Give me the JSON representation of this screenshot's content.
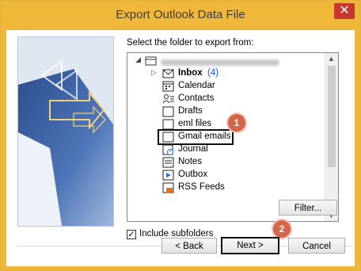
{
  "window": {
    "title": "Export Outlook Data File",
    "close_glyph": "✕"
  },
  "prompt": "Select the folder to export from:",
  "tree": {
    "items": [
      {
        "label": "Inbox",
        "count": "(4)",
        "icon": "inbox-icon"
      },
      {
        "label": "Calendar",
        "icon": "calendar-icon"
      },
      {
        "label": "Contacts",
        "icon": "contacts-icon"
      },
      {
        "label": "Drafts",
        "icon": "folder-icon"
      },
      {
        "label": "eml files",
        "icon": "folder-icon"
      },
      {
        "label": "Gmail emails",
        "icon": "folder-icon"
      },
      {
        "label": "Journal",
        "icon": "journal-icon"
      },
      {
        "label": "Notes",
        "icon": "notes-icon"
      },
      {
        "label": "Outbox",
        "icon": "outbox-icon"
      },
      {
        "label": "RSS Feeds",
        "icon": "rss-icon"
      }
    ]
  },
  "include_subfolders": {
    "label": "Include subfolders",
    "checked": true
  },
  "buttons": {
    "filter": "Filter...",
    "back": "< Back",
    "next": "Next >",
    "cancel": "Cancel"
  },
  "annotations": {
    "badge_1": "1",
    "badge_2": "2"
  },
  "colors": {
    "title_bar": "#f0b83a",
    "badge": "#d4654b",
    "close": "#c7392e",
    "inbox_count": "#1a4fd6"
  }
}
